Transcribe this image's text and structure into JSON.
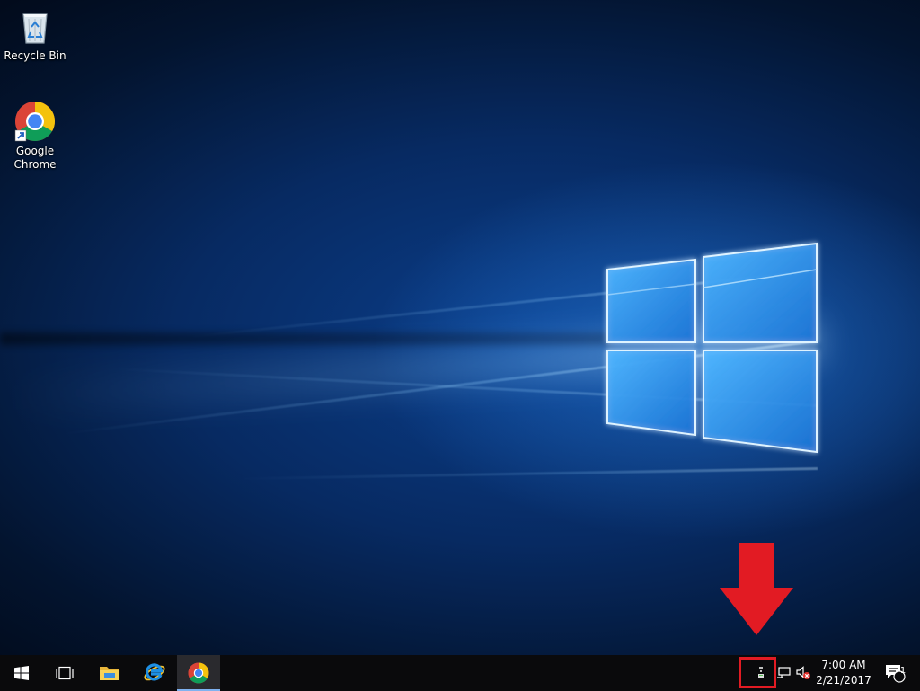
{
  "desktop": {
    "icons": [
      {
        "label": "Recycle Bin",
        "icon": "recycle-bin-icon"
      },
      {
        "label": "Google\nChrome",
        "icon": "chrome-icon"
      }
    ]
  },
  "taskbar": {
    "buttons": [
      {
        "name": "start",
        "icon": "windows-start-icon"
      },
      {
        "name": "task-view",
        "icon": "task-view-icon"
      },
      {
        "name": "file-explorer",
        "icon": "folder-icon"
      },
      {
        "name": "internet-explorer",
        "icon": "internet-explorer-icon"
      },
      {
        "name": "google-chrome",
        "icon": "chrome-icon",
        "active": true
      }
    ],
    "tray": {
      "icons": [
        "usb-device-icon",
        "network-icon",
        "volume-muted-icon"
      ],
      "clock": {
        "time": "7:00 AM",
        "date": "2/21/2017"
      },
      "notifications": {
        "count": "1",
        "icon": "action-center-icon"
      }
    }
  },
  "annotation": {
    "color": "#e21b23",
    "type": "red-arrow-and-box"
  },
  "colors": {
    "taskbar": "#0a0a0c",
    "accent": "#7fb2f0",
    "desktop_blue": "#0b3f8c"
  }
}
